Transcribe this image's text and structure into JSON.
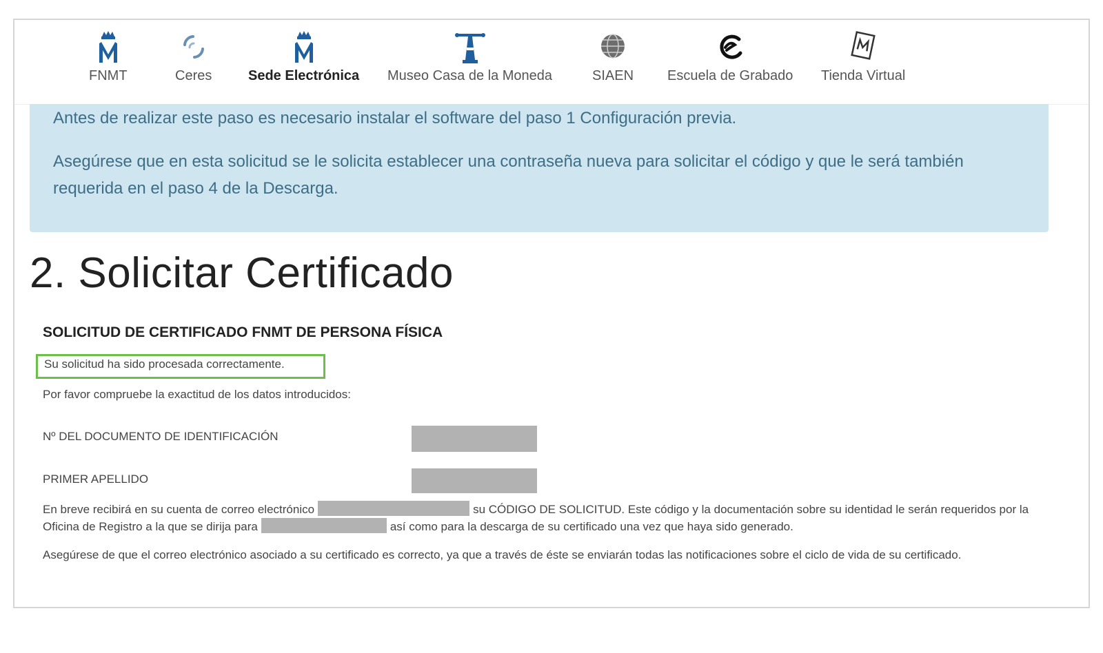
{
  "nav": {
    "items": [
      {
        "label": "FNMT",
        "icon": "crown-m-icon",
        "active": false
      },
      {
        "label": "Ceres",
        "icon": "ceres-swirl-icon",
        "active": false
      },
      {
        "label": "Sede Electrónica",
        "icon": "crown-m-icon",
        "active": true
      },
      {
        "label": "Museo Casa de la Moneda",
        "icon": "coin-press-icon",
        "active": false
      },
      {
        "label": "SIAEN",
        "icon": "globe-seal-icon",
        "active": false
      },
      {
        "label": "Escuela de Grabado",
        "icon": "engraving-logo-icon",
        "active": false
      },
      {
        "label": "Tienda Virtual",
        "icon": "shop-seal-icon",
        "active": false
      }
    ]
  },
  "alert": {
    "line1": "Antes de realizar este paso es necesario instalar el software del paso 1 Configuración previa.",
    "line2": "Asegúrese que en esta solicitud se le solicita establecer una contraseña nueva para solicitar el código y que le será también requerida en el paso 4 de la Descarga."
  },
  "page": {
    "title": "2. Solicitar Certificado",
    "section_title": "SOLICITUD DE CERTIFICADO FNMT DE PERSONA FÍSICA",
    "success_message": "Su solicitud ha sido procesada correctamente.",
    "instruction": "Por favor compruebe la exactitud de los datos introducidos:",
    "fields": {
      "id_label": "Nº DEL DOCUMENTO DE IDENTIFICACIÓN",
      "surname_label": "PRIMER APELLIDO"
    },
    "info_paragraph": {
      "part1": "En breve recibirá en su cuenta de correo electrónico",
      "part2": "su CÓDIGO DE SOLICITUD. Este código y la documentación sobre su identidad le serán requeridos por la Oficina de Registro a la que se dirija para",
      "part3": "así como para la descarga de su certificado una vez que haya sido generado."
    },
    "email_note": "Asegúrese de que el correo electrónico asociado a su certificado es correcto, ya que a través de éste se enviarán todas las notificaciones sobre el ciclo de vida de su certificado."
  },
  "colors": {
    "alert_bg": "#cfe6f1",
    "alert_text": "#3e6e86",
    "success_border": "#6cc04a",
    "brand_blue": "#1f5f9e",
    "redaction": "#b2b2b2"
  }
}
